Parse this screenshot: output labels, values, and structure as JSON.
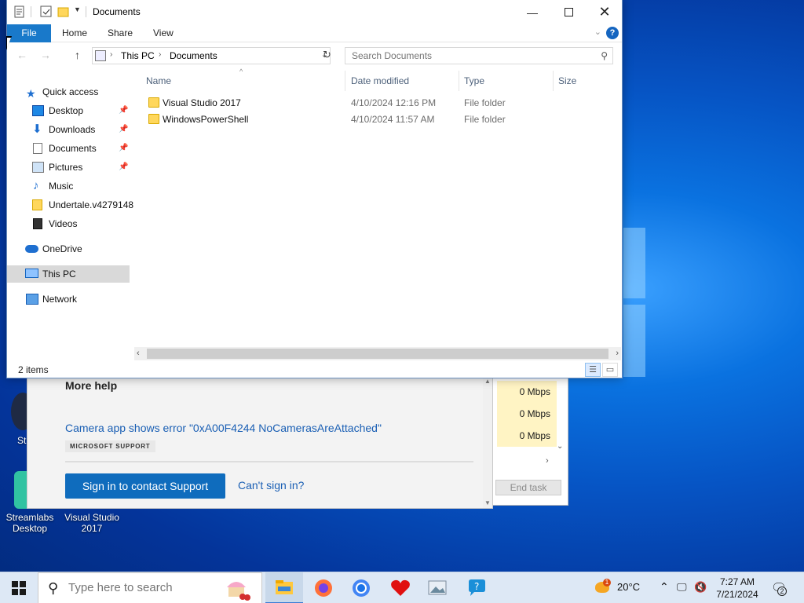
{
  "explorer": {
    "title": "Documents",
    "ribbon_tabs": [
      "File",
      "Home",
      "Share",
      "View"
    ],
    "address": {
      "crumbs": [
        "This PC",
        "Documents"
      ]
    },
    "search_placeholder": "Search Documents",
    "columns": [
      "Name",
      "Date modified",
      "Type",
      "Size"
    ],
    "nav": {
      "quick_access": "Quick access",
      "items": [
        {
          "label": "Desktop",
          "pinned": true,
          "icon": "desktop-icon"
        },
        {
          "label": "Downloads",
          "pinned": true,
          "icon": "downloads-icon"
        },
        {
          "label": "Documents",
          "pinned": true,
          "icon": "documents-icon"
        },
        {
          "label": "Pictures",
          "pinned": true,
          "icon": "pictures-icon"
        },
        {
          "label": "Music",
          "pinned": false,
          "icon": "music-icon"
        },
        {
          "label": "Undertale.v4279148",
          "pinned": false,
          "icon": "folder-icon"
        },
        {
          "label": "Videos",
          "pinned": false,
          "icon": "videos-icon"
        }
      ],
      "onedrive": "OneDrive",
      "this_pc": "This PC",
      "network": "Network"
    },
    "files": [
      {
        "name": "Visual Studio 2017",
        "date": "4/10/2024 12:16 PM",
        "type": "File folder"
      },
      {
        "name": "WindowsPowerShell",
        "date": "4/10/2024 11:57 AM",
        "type": "File folder"
      }
    ],
    "status": "2 items"
  },
  "gethelp": {
    "more_help": "More help",
    "link": "Camera app shows error \"0xA00F4244 NoCamerasAreAttached\"",
    "source": "MICROSOFT SUPPORT",
    "signin": "Sign in to contact Support",
    "cant_signin": "Can't sign in?"
  },
  "taskmgr": {
    "rates": [
      "0 Mbps",
      "0 Mbps",
      "0 Mbps"
    ],
    "end_task": "End task"
  },
  "desktop": {
    "icons": [
      {
        "label": "Streamlabs Desktop",
        "color": "#31c3a2"
      },
      {
        "label": "Visual Studio 2017",
        "color": "#68217a"
      }
    ],
    "partial_label": "St"
  },
  "taskbar": {
    "search_placeholder": "Type here to search",
    "weather": {
      "temp": "20°C",
      "badge": "1"
    },
    "clock": {
      "time": "7:27 AM",
      "date": "7/21/2024"
    },
    "notifications": "2"
  },
  "colors": {
    "accent": "#0f6cbd",
    "file_tab": "#1979ca",
    "folder": "#ffd75c"
  }
}
